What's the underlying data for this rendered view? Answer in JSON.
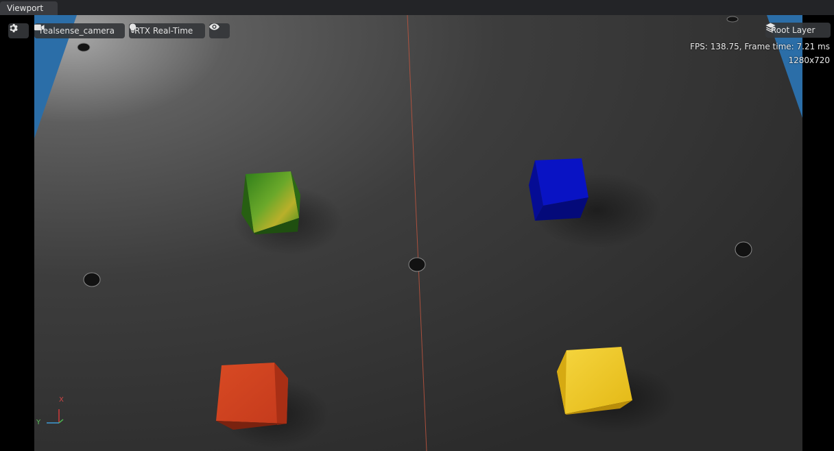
{
  "tab": {
    "label": "Viewport"
  },
  "toolbar": {
    "camera_label": "realsense_camera",
    "render_mode_label": "RTX Real-Time",
    "layer_label": "Root Layer"
  },
  "stats": {
    "fps_text": "FPS: 138.75, Frame time: 7.21 ms",
    "resolution_text": "1280x720"
  },
  "axis": {
    "x_label": "X",
    "y_label": "Y"
  },
  "colors": {
    "cube_green": "#3f8f1e",
    "cube_blue": "#0a14c8",
    "cube_red": "#d2401f",
    "cube_yellow": "#f0c820",
    "ground": "#3c3c3c",
    "backdrop": "#2f6fa6"
  },
  "icons": [
    "gear-icon",
    "camera-icon",
    "bulb-icon",
    "eye-icon",
    "layers-icon"
  ]
}
